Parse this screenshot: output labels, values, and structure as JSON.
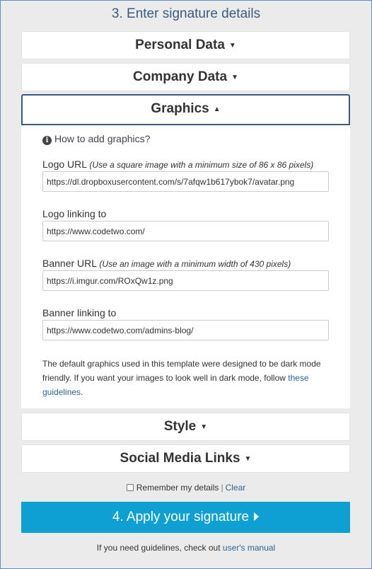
{
  "step_title": "3. Enter signature details",
  "panels": {
    "personal": {
      "label": "Personal Data",
      "caret": "▼"
    },
    "company": {
      "label": "Company Data",
      "caret": "▼"
    },
    "graphics": {
      "label": "Graphics",
      "caret": "▲"
    },
    "style": {
      "label": "Style",
      "caret": "▼"
    },
    "social": {
      "label": "Social Media Links",
      "caret": "▼"
    }
  },
  "graphics": {
    "howto_icon": "i",
    "howto_label": "How to add graphics?",
    "logo_url": {
      "label": "Logo URL",
      "hint": "(Use a square image with a minimum size of 86 x 86 pixels)",
      "value": "https://dl.dropboxusercontent.com/s/7afqw1b617ybok7/avatar.png"
    },
    "logo_link": {
      "label": "Logo linking to",
      "value": "https://www.codetwo.com/"
    },
    "banner_url": {
      "label": "Banner URL",
      "hint": "(Use an image with a minimum width of 430 pixels)",
      "value": "https://i.imgur.com/ROxQw1z.png"
    },
    "banner_link": {
      "label": "Banner linking to",
      "value": "https://www.codetwo.com/admins-blog/"
    },
    "note_text": "The default graphics used in this template were designed to be dark mode friendly. If you want your images to look well in dark mode, follow ",
    "note_link": "these guidelines",
    "note_end": "."
  },
  "remember": {
    "label": "Remember my details",
    "separator": "|",
    "clear": "Clear"
  },
  "apply_button": "4. Apply your signature",
  "footer": {
    "text": "If you need guidelines, check out ",
    "link": "user's manual"
  },
  "colors": {
    "accent": "#0ea0d2",
    "title": "#3b5a80",
    "link": "#2a6496",
    "background": "#ebebeb"
  }
}
